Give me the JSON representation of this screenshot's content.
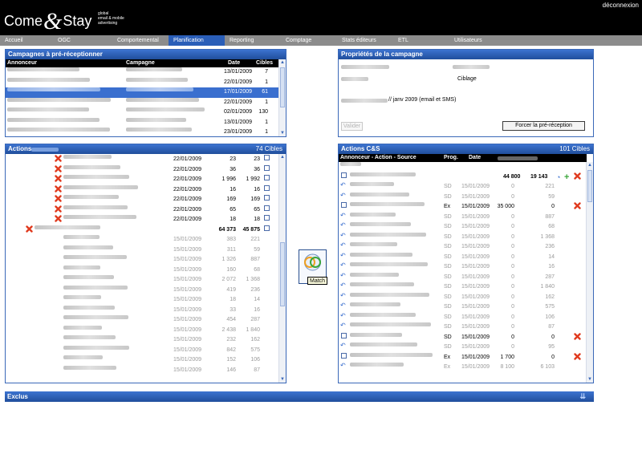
{
  "header": {
    "brand_left": "Come",
    "brand_amp": "&",
    "brand_right": "Stay",
    "tagline": [
      "global",
      "email & mobile",
      "advertising"
    ],
    "logout": "déconnexion"
  },
  "nav": [
    "Accueil",
    "OGC",
    "Comportemental",
    "Planification",
    "Reporting",
    "Comptage",
    "Stats éditeurs",
    "ETL",
    "Utilisateurs"
  ],
  "nav_active": "Planification",
  "campaigns": {
    "title": "Campagnes à pré-réceptionner",
    "columns": [
      "Annonceur",
      "Campagne",
      "Date",
      "Cibles"
    ],
    "rows": [
      {
        "date": "13/01/2009",
        "cibles": "7"
      },
      {
        "date": "22/01/2009",
        "cibles": "1"
      },
      {
        "date": "17/01/2009",
        "cibles": "61"
      },
      {
        "date": "22/01/2009",
        "cibles": "1"
      },
      {
        "date": "02/01/2009",
        "cibles": "130"
      },
      {
        "date": "13/01/2009",
        "cibles": "1"
      },
      {
        "date": "23/01/2009",
        "cibles": "1"
      }
    ]
  },
  "properties": {
    "title": "Propriétés de la campagne",
    "ciblage": "Ciblage",
    "period_text": "// janv 2009 (email et SMS)",
    "validate": "Valider",
    "force": "Forcer la pré-réception"
  },
  "actions": {
    "title": "Actions",
    "count": "74 Cibles",
    "rows": [
      {
        "date": "22/01/2009",
        "a": "23",
        "b": "23"
      },
      {
        "date": "22/01/2009",
        "a": "36",
        "b": "36"
      },
      {
        "date": "22/01/2009",
        "a": "1 996",
        "b": "1 992"
      },
      {
        "date": "22/01/2009",
        "a": "16",
        "b": "16"
      },
      {
        "date": "22/01/2009",
        "a": "169",
        "b": "169"
      },
      {
        "date": "22/01/2009",
        "a": "65",
        "b": "65"
      },
      {
        "date": "22/01/2009",
        "a": "18",
        "b": "18"
      }
    ],
    "total": {
      "a": "64 373",
      "b": "45 875"
    },
    "grey_rows": [
      {
        "date": "15/01/2009",
        "a": "383",
        "b": "221"
      },
      {
        "date": "15/01/2009",
        "a": "311",
        "b": "59"
      },
      {
        "date": "15/01/2009",
        "a": "1 326",
        "b": "887"
      },
      {
        "date": "15/01/2009",
        "a": "160",
        "b": "68"
      },
      {
        "date": "15/01/2009",
        "a": "2 072",
        "b": "1 368"
      },
      {
        "date": "15/01/2009",
        "a": "419",
        "b": "236"
      },
      {
        "date": "15/01/2009",
        "a": "18",
        "b": "14"
      },
      {
        "date": "15/01/2009",
        "a": "33",
        "b": "16"
      },
      {
        "date": "15/01/2009",
        "a": "454",
        "b": "287"
      },
      {
        "date": "15/01/2009",
        "a": "2 438",
        "b": "1 840"
      },
      {
        "date": "15/01/2009",
        "a": "232",
        "b": "162"
      },
      {
        "date": "15/01/2009",
        "a": "842",
        "b": "575"
      },
      {
        "date": "15/01/2009",
        "a": "152",
        "b": "106"
      },
      {
        "date": "15/01/2009",
        "a": "146",
        "b": "87"
      }
    ]
  },
  "match_label": "Match",
  "cs": {
    "title": "Actions C&S",
    "count": "101 Cibles",
    "columns": [
      "Annonceur - Action - Source",
      "Prog.",
      "Date"
    ],
    "top": {
      "a": "44 800",
      "b": "19 143"
    },
    "rows": [
      {
        "prog": "SD",
        "date": "15/01/2009",
        "a": "0",
        "b": "221",
        "grey": true
      },
      {
        "prog": "SD",
        "date": "15/01/2009",
        "a": "0",
        "b": "59",
        "grey": true
      },
      {
        "prog": "Ex",
        "date": "15/01/2009",
        "a": "35 000",
        "b": "0",
        "grey": false,
        "x": true
      },
      {
        "prog": "SD",
        "date": "15/01/2009",
        "a": "0",
        "b": "887",
        "grey": true
      },
      {
        "prog": "SD",
        "date": "15/01/2009",
        "a": "0",
        "b": "68",
        "grey": true
      },
      {
        "prog": "SD",
        "date": "15/01/2009",
        "a": "0",
        "b": "1 368",
        "grey": true
      },
      {
        "prog": "SD",
        "date": "15/01/2009",
        "a": "0",
        "b": "236",
        "grey": true
      },
      {
        "prog": "SD",
        "date": "15/01/2009",
        "a": "0",
        "b": "14",
        "grey": true
      },
      {
        "prog": "SD",
        "date": "15/01/2009",
        "a": "0",
        "b": "16",
        "grey": true
      },
      {
        "prog": "SD",
        "date": "15/01/2009",
        "a": "0",
        "b": "287",
        "grey": true
      },
      {
        "prog": "SD",
        "date": "15/01/2009",
        "a": "0",
        "b": "1 840",
        "grey": true
      },
      {
        "prog": "SD",
        "date": "15/01/2009",
        "a": "0",
        "b": "162",
        "grey": true
      },
      {
        "prog": "SD",
        "date": "15/01/2009",
        "a": "0",
        "b": "575",
        "grey": true
      },
      {
        "prog": "SD",
        "date": "15/01/2009",
        "a": "0",
        "b": "106",
        "grey": true
      },
      {
        "prog": "SD",
        "date": "15/01/2009",
        "a": "0",
        "b": "87",
        "grey": true
      },
      {
        "prog": "SD",
        "date": "15/01/2009",
        "a": "0",
        "b": "0",
        "grey": false,
        "x": true
      },
      {
        "prog": "SD",
        "date": "15/01/2009",
        "a": "0",
        "b": "95",
        "grey": true
      },
      {
        "prog": "Ex",
        "date": "15/01/2009",
        "a": "1 700",
        "b": "0",
        "grey": false,
        "x": true
      },
      {
        "prog": "Ex",
        "date": "15/01/2009",
        "a": "8 100",
        "b": "6 103",
        "grey": true
      }
    ]
  },
  "exclus": "Exclus",
  "colors": {
    "accent": "#2a5eb8",
    "selected": "#3a6fcf",
    "nav": "#8c8c8c",
    "delete": "#e03a1e",
    "add": "#3aa63a"
  }
}
